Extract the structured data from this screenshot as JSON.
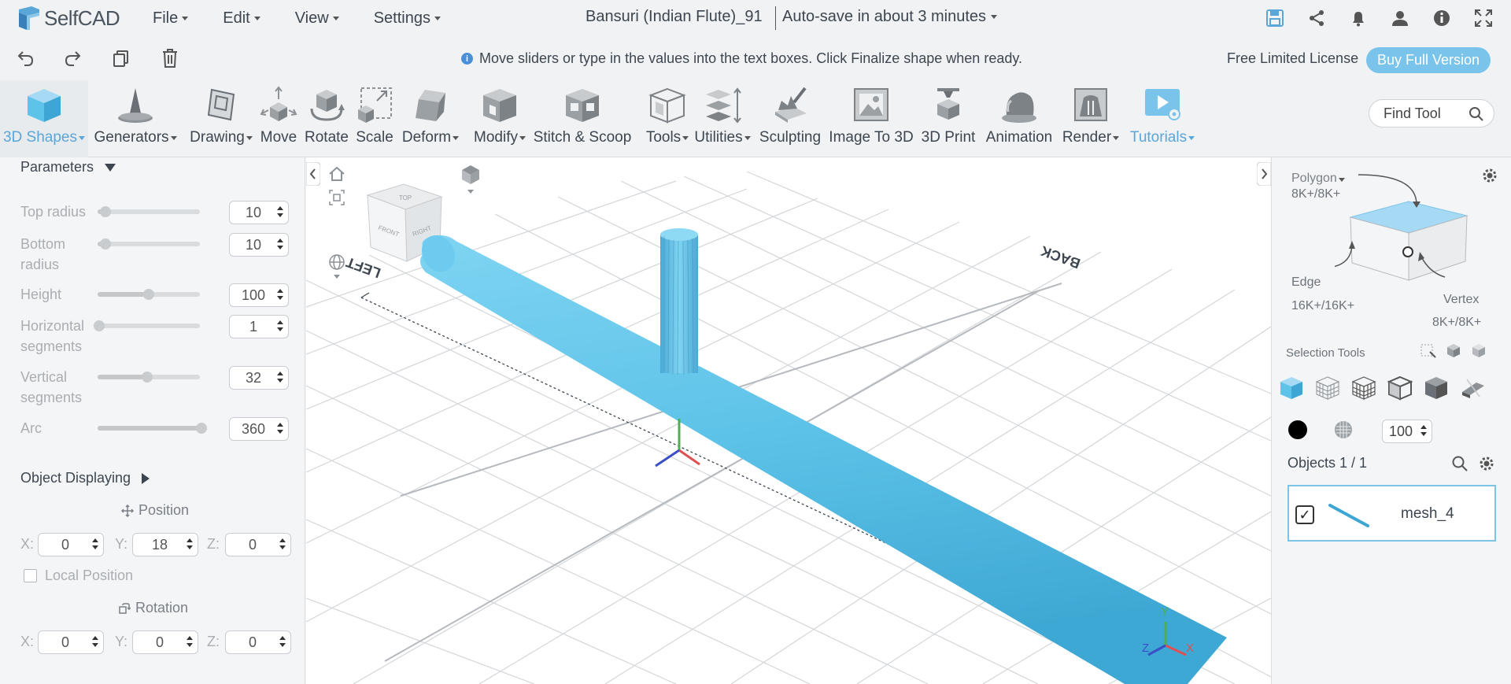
{
  "app": {
    "name": "SelfCAD"
  },
  "menu": [
    {
      "label": "File"
    },
    {
      "label": "Edit"
    },
    {
      "label": "View"
    },
    {
      "label": "Settings"
    }
  ],
  "document": {
    "title": "Bansuri (Indian Flute)_91",
    "autosave": "Auto-save in about 3 minutes"
  },
  "top_icons": [
    "save-icon",
    "share-icon",
    "bell-icon",
    "user-icon",
    "info-icon",
    "fullscreen-icon"
  ],
  "toolbar2": {
    "hint": "Move sliders or type in the values into the text boxes. Click Finalize shape when ready.",
    "license": "Free Limited License",
    "buy_label": "Buy Full Version"
  },
  "tools": [
    {
      "label": "3D Shapes",
      "dropdown": true
    },
    {
      "label": "Generators",
      "dropdown": true
    },
    {
      "label": "Drawing",
      "dropdown": true
    },
    {
      "label": "Move",
      "dropdown": false
    },
    {
      "label": "Rotate",
      "dropdown": false
    },
    {
      "label": "Scale",
      "dropdown": false
    },
    {
      "label": "Deform",
      "dropdown": true
    },
    {
      "label": "Modify",
      "dropdown": true
    },
    {
      "label": "Stitch & Scoop",
      "dropdown": false
    },
    {
      "label": "Tools",
      "dropdown": true
    },
    {
      "label": "Utilities",
      "dropdown": true
    },
    {
      "label": "Sculpting",
      "dropdown": false
    },
    {
      "label": "Image To 3D",
      "dropdown": false
    },
    {
      "label": "3D Print",
      "dropdown": false
    },
    {
      "label": "Animation",
      "dropdown": false
    },
    {
      "label": "Render",
      "dropdown": true
    },
    {
      "label": "Tutorials",
      "dropdown": true
    }
  ],
  "find_tool": {
    "placeholder": "Find Tool"
  },
  "parameters": {
    "heading": "Parameters",
    "items": [
      {
        "label": "Top radius",
        "value": "10",
        "fraction": 0.08
      },
      {
        "label": "Bottom radius",
        "value": "10",
        "fraction": 0.08
      },
      {
        "label": "Height",
        "value": "100",
        "fraction": 0.5
      },
      {
        "label": "Horizontal segments",
        "value": "1",
        "fraction": 0.0
      },
      {
        "label": "Vertical segments",
        "value": "32",
        "fraction": 0.48
      },
      {
        "label": "Arc",
        "value": "360",
        "fraction": 1.0
      }
    ]
  },
  "object_displaying": {
    "heading": "Object Displaying",
    "position_label": "Position",
    "position": {
      "x": "0",
      "y": "18",
      "z": "0"
    },
    "local_position_label": "Local Position",
    "rotation_label": "Rotation",
    "rotation": {
      "x": "0",
      "y": "0",
      "z": "0"
    },
    "axis_x": "X:",
    "axis_y": "Y:",
    "axis_z": "Z:"
  },
  "viewport": {
    "cube_faces": {
      "top": "TOP",
      "front": "FRONT",
      "right": "RIGHT"
    },
    "ground_label_left": "LEFT",
    "ground_label_back": "BACK",
    "gizmo_labels": {
      "x": "X",
      "y": "Y",
      "z": "Z"
    },
    "colors": {
      "mesh": "#5ec3e8",
      "grid": "#cfd3d6",
      "x_axis": "#e05050",
      "y_axis": "#4caf50",
      "z_axis": "#3a4fc8"
    }
  },
  "selection_cube": {
    "polygon": "Polygon",
    "polygon_count": "8K+/8K+",
    "edge": "Edge",
    "edge_count": "16K+/16K+",
    "vertex": "Vertex",
    "vertex_count": "8K+/8K+"
  },
  "selection_tools": {
    "label": "Selection Tools"
  },
  "opacity": {
    "value": "100"
  },
  "objects": {
    "heading": "Objects 1 / 1",
    "items": [
      {
        "name": "mesh_4",
        "checked": true
      }
    ]
  }
}
